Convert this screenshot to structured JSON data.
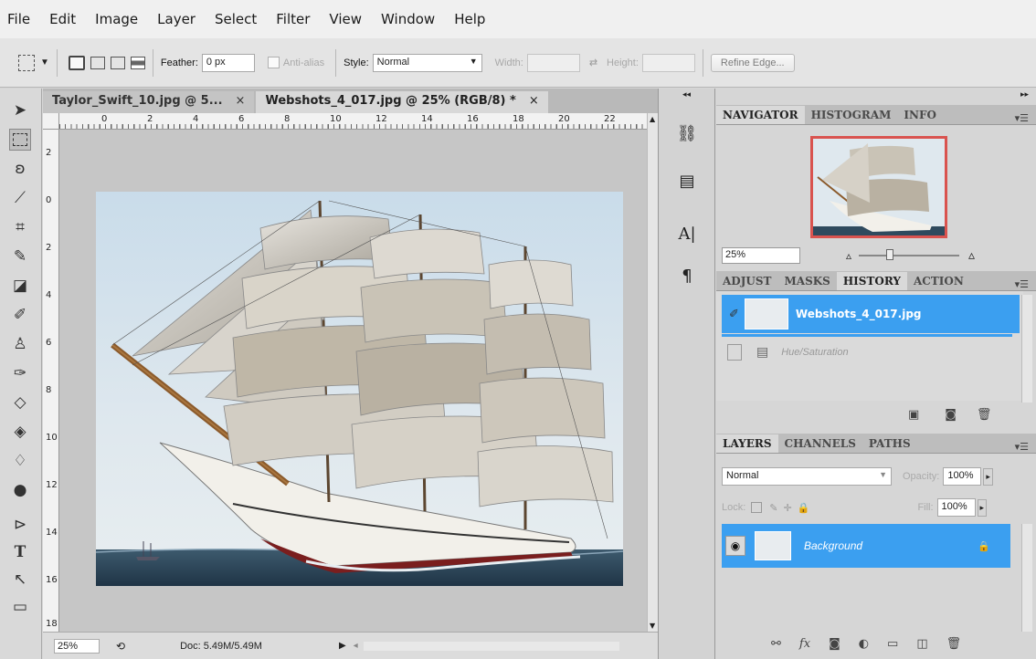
{
  "menubar": [
    "File",
    "Edit",
    "Image",
    "Layer",
    "Select",
    "Filter",
    "View",
    "Window",
    "Help"
  ],
  "options": {
    "feather_label": "Feather:",
    "feather_value": "0 px",
    "antialias_label": "Anti-alias",
    "style_label": "Style:",
    "style_value": "Normal",
    "width_label": "Width:",
    "height_label": "Height:",
    "refine_edge": "Refine Edge..."
  },
  "tabs": [
    {
      "label": "Taylor_Swift_10.jpg @ 5...",
      "close": "×"
    },
    {
      "label": "Webshots_4_017.jpg @ 25% (RGB/8) *",
      "close": "×"
    }
  ],
  "hruler_ticks": [
    "0",
    "2",
    "4",
    "6",
    "8",
    "10",
    "12",
    "14",
    "16",
    "18",
    "20",
    "22"
  ],
  "vruler_ticks": [
    "2",
    "0",
    "2",
    "4",
    "6",
    "8",
    "10",
    "12",
    "14",
    "16",
    "18"
  ],
  "status": {
    "zoom": "25%",
    "doc": "Doc: 5.49M/5.49M"
  },
  "navigator": {
    "tabs": [
      "NAVIGATOR",
      "HISTOGRAM",
      "INFO"
    ],
    "zoom": "25%"
  },
  "history": {
    "tabs": [
      "ADJUST",
      "MASKS",
      "HISTORY",
      "ACTION"
    ],
    "snapshot": "Webshots_4_017.jpg",
    "step": "Hue/Saturation"
  },
  "layers": {
    "tabs": [
      "LAYERS",
      "CHANNELS",
      "PATHS"
    ],
    "blend": "Normal",
    "opacity_label": "Opacity:",
    "opacity": "100%",
    "lock_label": "Lock:",
    "fill_label": "Fill:",
    "fill": "100%",
    "layer_name": "Background"
  },
  "colors": {
    "selection": "#3b9ff0",
    "nav_box": "#d9534f"
  }
}
